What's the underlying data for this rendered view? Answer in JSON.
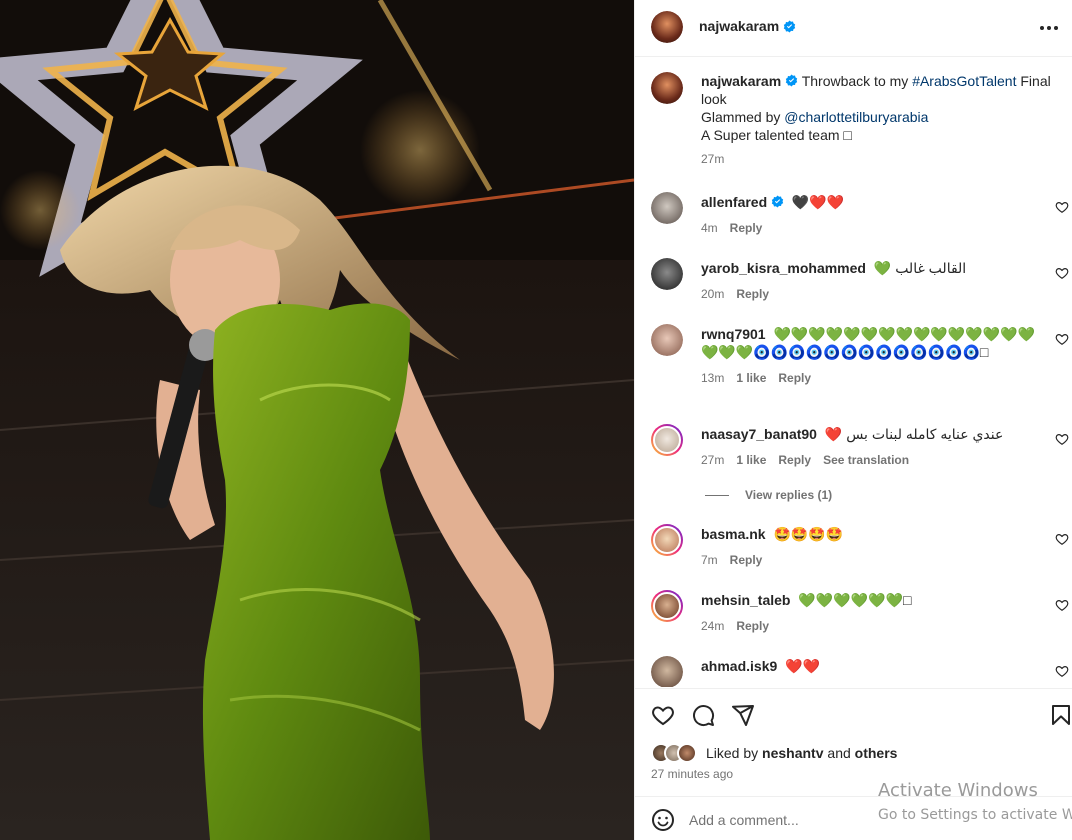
{
  "post": {
    "author": "najwakaram",
    "verified": true
  },
  "caption": {
    "username": "najwakaram",
    "text_before": "Throwback to my ",
    "hashtag": "#ArabsGotTalent",
    "text_after": " Final look",
    "line2_prefix": "Glammed by ",
    "mention": "@charlottetilburyarabia",
    "line3": "A Super talented team □",
    "time": "27m"
  },
  "comments": [
    {
      "username": "allenfared",
      "verified": true,
      "text": "🖤❤️❤️",
      "time": "4m",
      "likes": "",
      "reply": "Reply",
      "translate": ""
    },
    {
      "username": "yarob_kisra_mohammed",
      "verified": false,
      "text": "💚 القالب غالب",
      "time": "20m",
      "likes": "",
      "reply": "Reply",
      "translate": ""
    },
    {
      "username": "rwnq7901",
      "verified": false,
      "text": "💚💚💚💚💚💚💚💚💚💚💚💚💚💚💚💚💚💚🧿🧿🧿🧿🧿🧿🧿🧿🧿🧿🧿🧿🧿□",
      "time": "13m",
      "likes": "1 like",
      "reply": "Reply",
      "translate": ""
    },
    {
      "username": "naasay7_banat90",
      "verified": false,
      "text": "❤️ عندي عنايه كامله لبنات بس",
      "time": "27m",
      "likes": "1 like",
      "reply": "Reply",
      "translate": "See translation"
    },
    {
      "username": "basma.nk",
      "verified": false,
      "text": "🤩🤩🤩🤩",
      "time": "7m",
      "likes": "",
      "reply": "Reply",
      "translate": ""
    },
    {
      "username": "mehsin_taleb",
      "verified": false,
      "text": "💚💚💚💚💚💚□",
      "time": "24m",
      "likes": "",
      "reply": "Reply",
      "translate": ""
    },
    {
      "username": "ahmad.isk9",
      "verified": false,
      "text": "❤️❤️",
      "time": "",
      "likes": "",
      "reply": "",
      "translate": ""
    }
  ],
  "view_replies": "View replies (1)",
  "likes": {
    "prefix": "Liked by ",
    "user": "neshantv",
    "middle": " and ",
    "others": "others"
  },
  "posted_ago": "27 minutes ago",
  "add_comment": {
    "placeholder": "Add a comment..."
  },
  "watermark": {
    "line1": "Activate Windows",
    "line2": "Go to Settings to activate Win"
  },
  "colors": {
    "link": "#00376b",
    "verified": "#0095f6",
    "muted": "#737373"
  }
}
